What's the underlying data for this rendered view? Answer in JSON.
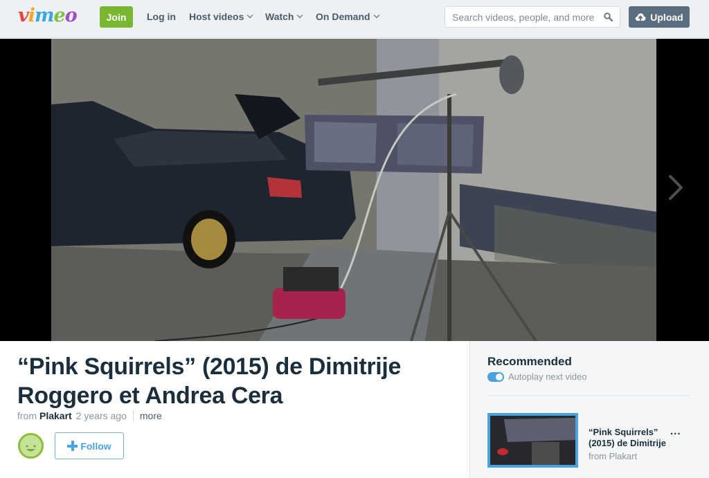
{
  "topbar": {
    "logo_letters": [
      "v",
      "i",
      "m",
      "e",
      "o"
    ],
    "join_label": "Join",
    "login_label": "Log in",
    "nav": [
      {
        "label": "Host videos",
        "has_dropdown": true
      },
      {
        "label": "Watch",
        "has_dropdown": true
      },
      {
        "label": "On Demand",
        "has_dropdown": true
      }
    ],
    "search": {
      "placeholder": "Search videos, people, and more",
      "value": "",
      "icon": "search-icon"
    },
    "upload_label": "Upload",
    "upload_icon": "cloud-upload-icon"
  },
  "player": {
    "next_icon": "chevron-right-icon"
  },
  "video": {
    "title": "“Pink Squirrels” (2015) de Dimitrije Roggero et Andrea Cera",
    "from_label": "from",
    "owner": "Plakart",
    "age": "2 years ago",
    "more_label": "more",
    "follow_label": "Follow"
  },
  "sidebar": {
    "title": "Recommended",
    "autoplay_label": "Autoplay next video",
    "autoplay_on": true,
    "items": [
      {
        "title": "“Pink Squirrels” (2015) de Dimitrije",
        "from": "from Plakart",
        "more": "..."
      }
    ]
  },
  "colors": {
    "join_green": "#7ab730",
    "upload_slate": "#5a6e80",
    "accent_blue": "#4aa3df",
    "title_text": "#1a2e3b"
  }
}
